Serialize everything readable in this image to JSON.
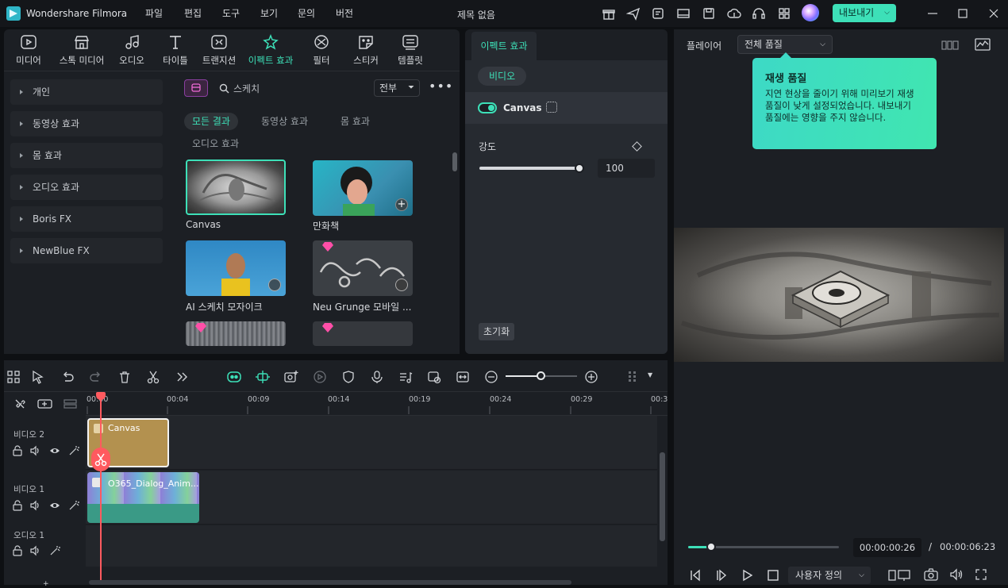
{
  "app": {
    "name": "Wondershare Filmora",
    "doc_title": "제목 없음",
    "export_label": "내보내기",
    "colors": {
      "accent": "#3fd4b0",
      "tooltip": "#3de0b8",
      "clip_yellow": "#b3914f",
      "clip_green": "#3a9a86",
      "playhead": "#ff5a5f"
    }
  },
  "menu": [
    "파일",
    "편집",
    "도구",
    "보기",
    "문의",
    "버전"
  ],
  "topnav": [
    {
      "label": "미디어",
      "icon": "media-icon"
    },
    {
      "label": "스톡 미디어",
      "icon": "stock-media-icon"
    },
    {
      "label": "오디오",
      "icon": "audio-icon"
    },
    {
      "label": "타이틀",
      "icon": "title-icon"
    },
    {
      "label": "트랜지션",
      "icon": "transition-icon"
    },
    {
      "label": "이펙트 효과",
      "icon": "effects-icon",
      "active": true
    },
    {
      "label": "필터",
      "icon": "filter-icon"
    },
    {
      "label": "스티커",
      "icon": "sticker-icon"
    },
    {
      "label": "템플릿",
      "icon": "template-icon"
    }
  ],
  "sidebar": [
    "개인",
    "동영상 효과",
    "몸 효과",
    "오디오 효과",
    "Boris FX",
    "NewBlue FX"
  ],
  "browser": {
    "search_placeholder": "스케치",
    "filter_label": "전부",
    "tabs": [
      "모든 결과",
      "동영상 효과",
      "몸 효과",
      "오디오 효과"
    ],
    "items": [
      "Canvas",
      "만화책",
      "AI 스케치 모자이크",
      "Neu Grunge 모바일 ..."
    ]
  },
  "inspector": {
    "tab": "이펙트 효과",
    "sub_tab": "비디오",
    "effect_name": "Canvas",
    "param_label": "강도",
    "param_value": "100",
    "param_level": 1.0,
    "reset_label": "초기화"
  },
  "player": {
    "label": "플레이어",
    "quality": "전체 품질",
    "tooltip_title": "재생 품질",
    "tooltip_body": "지연 현상을 줄이기 위해 미리보기 재생 품질이 낮게 설정되었습니다. 내보내기 품질에는 영향을 주지 않습니다.",
    "current_time": "00:00:00:26",
    "separator": "/",
    "total_time": "00:00:06:23",
    "progress": 0.15,
    "custom_label": "사용자 정의"
  },
  "timeline": {
    "ruler": [
      "00:00",
      "00:04",
      "00:09",
      "00:14",
      "00:19",
      "00:24",
      "00:29",
      "00:3"
    ],
    "tracks": [
      "비디오 2",
      "비디오 1",
      "오디오 1"
    ],
    "clips": {
      "video2": "Canvas",
      "video1": "O365_Dialog_Anim..."
    }
  }
}
